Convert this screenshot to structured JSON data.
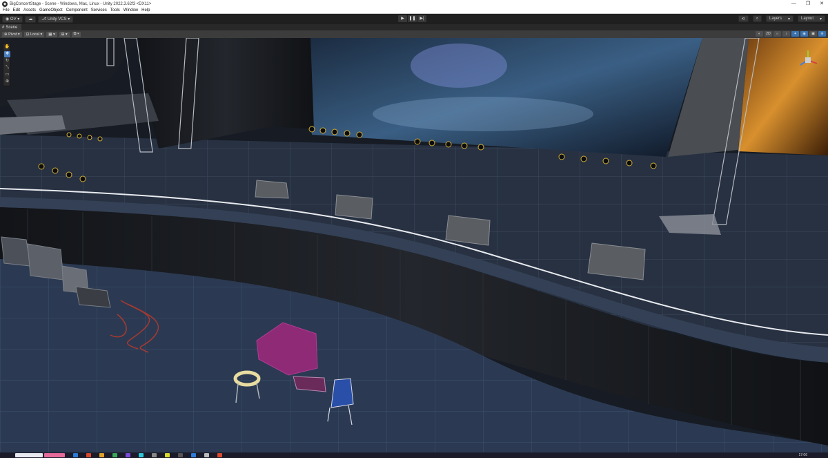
{
  "window": {
    "title": "BigConcertStage - Scene - Windows, Mac, Linux - Unity 2022.3.62f3 <DX11>",
    "minimize": "—",
    "maximize": "❐",
    "close": "✕"
  },
  "menu": [
    "File",
    "Edit",
    "Assets",
    "GameObject",
    "Component",
    "Services",
    "Tools",
    "Window",
    "Help"
  ],
  "main_toolbar": {
    "account": "OV",
    "vcs": "Unity VCS",
    "layers": "Layers",
    "layout": "Layout"
  },
  "scene_tab": {
    "label": "Scene"
  },
  "scene_toolbar": {
    "pivot": "Pivot",
    "local": "Local"
  },
  "taskbar": {
    "time": "17:06"
  },
  "colors": {
    "accent": "#4a7dbd",
    "chrome_dark": "#1f1f1f",
    "floor": "#2a3446"
  }
}
